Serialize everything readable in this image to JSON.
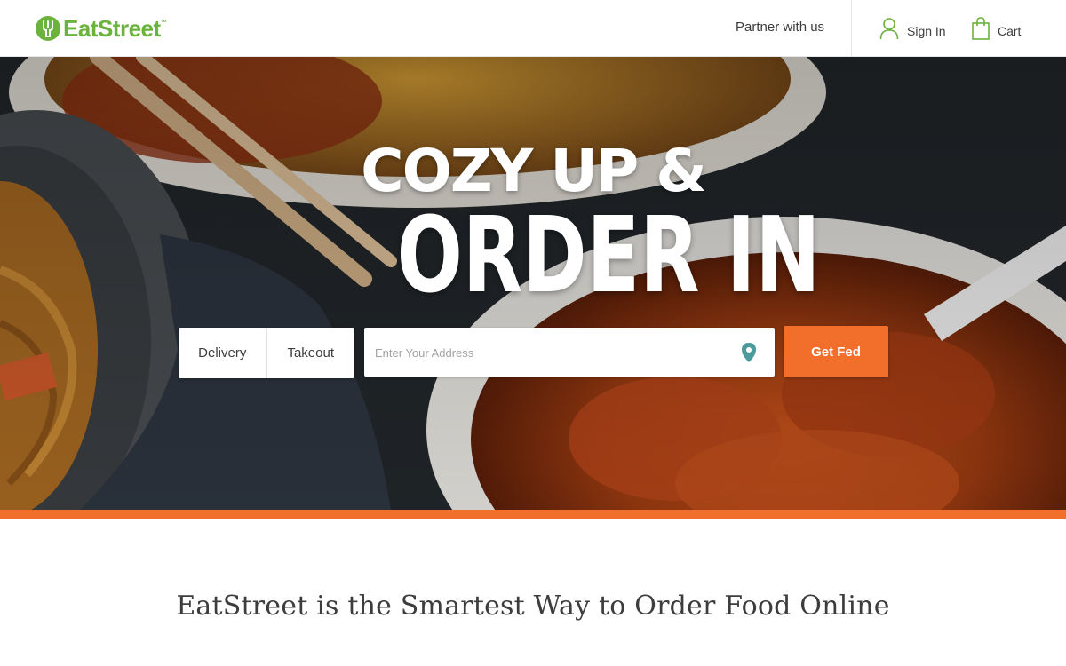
{
  "header": {
    "logo_text": "EatStreet",
    "logo_trademark": "™",
    "nav": {
      "partner": "Partner with us",
      "sign_in": "Sign In",
      "cart": "Cart"
    }
  },
  "hero": {
    "headline_line1": "COZY UP &",
    "headline_line2": "ORDER IN",
    "modes": [
      "Delivery",
      "Takeout"
    ],
    "address_placeholder": "Enter Your Address",
    "submit_label": "Get Fed"
  },
  "tagline": "EatStreet is the Smartest Way to Order Food Online",
  "colors": {
    "brand_green": "#6cb33e",
    "accent_orange": "#f26e2b",
    "text_dark": "#3d3d3d"
  },
  "icons": {
    "logo": "fork-leaf-icon",
    "sign_in": "user-icon",
    "cart": "shopping-bag-icon",
    "address": "map-pin-icon"
  }
}
